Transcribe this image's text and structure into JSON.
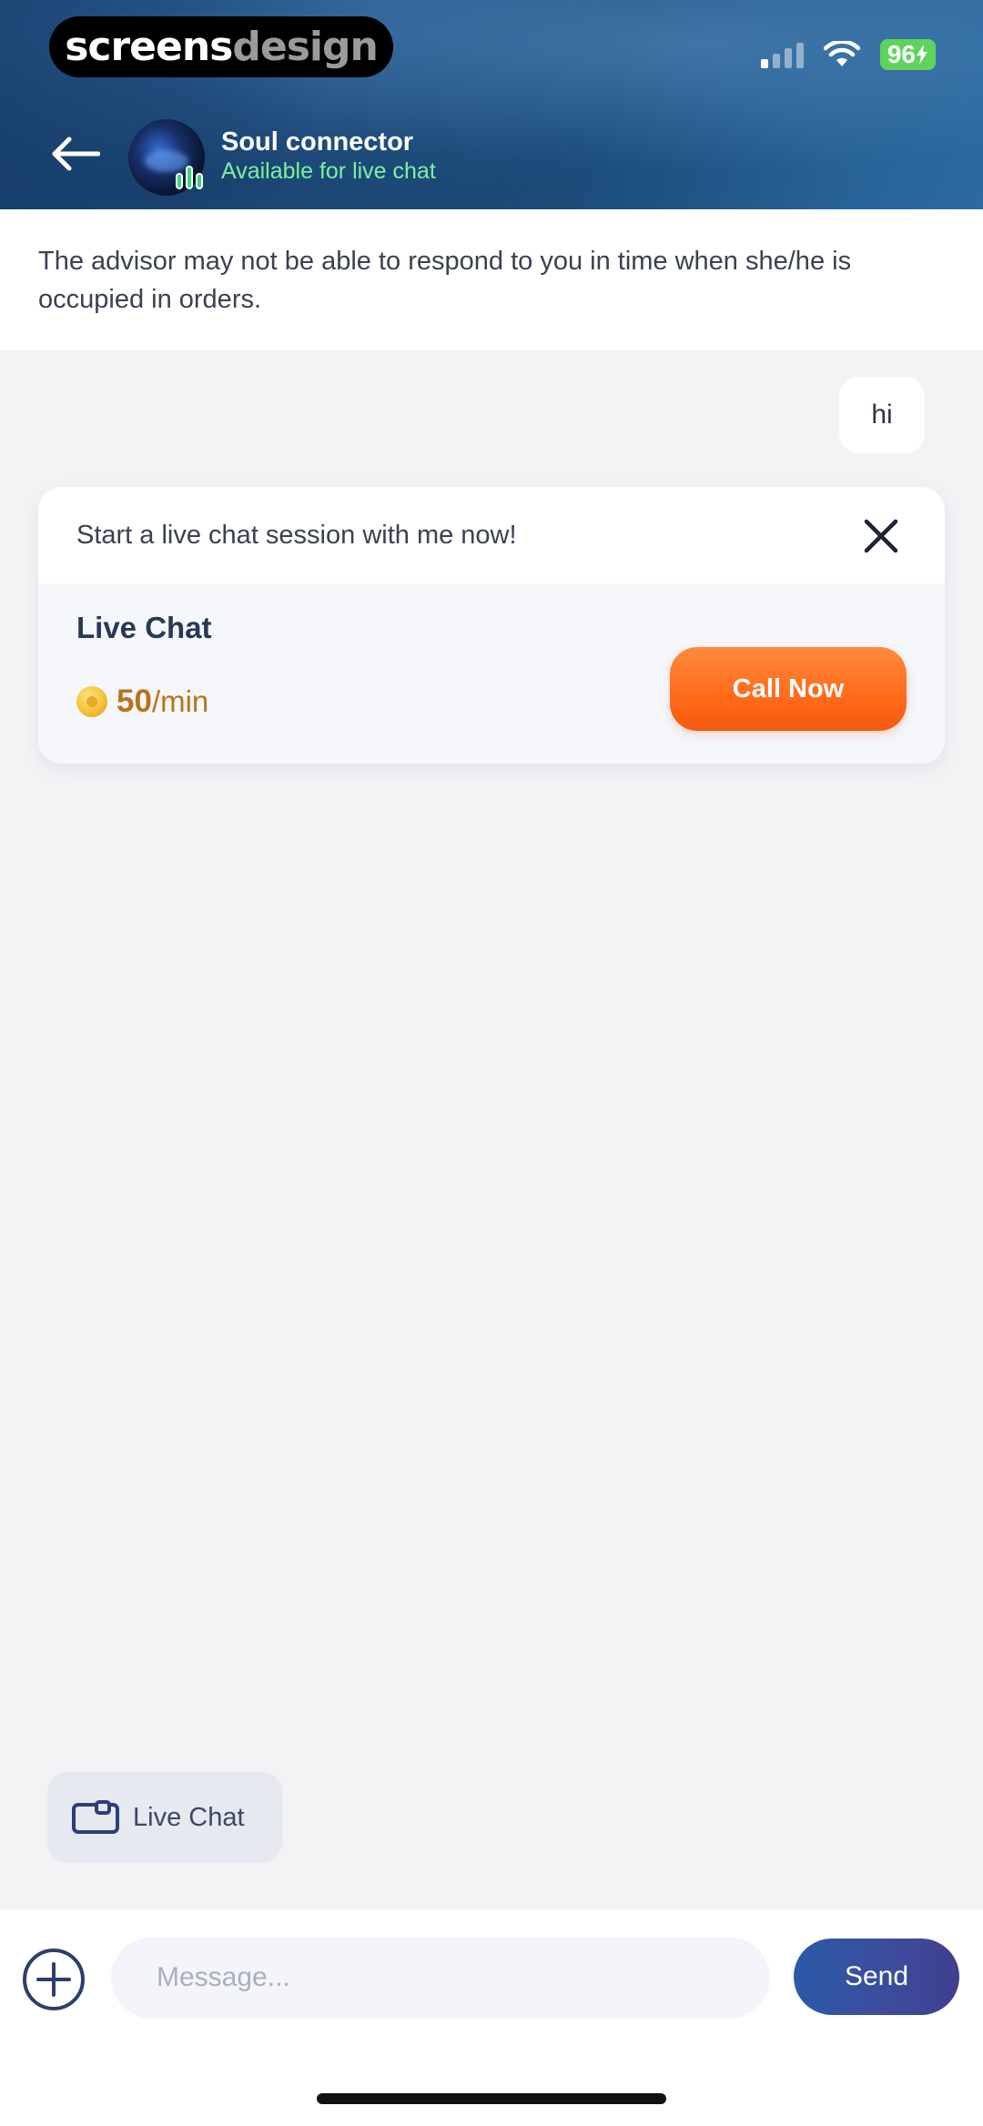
{
  "watermark": {
    "brand_main": "screens",
    "brand_muted": "design"
  },
  "status_bar": {
    "battery": "96",
    "signal_bars_active": 1
  },
  "header": {
    "contact_name": "Soul connector",
    "contact_status": "Available for live chat",
    "icons": {
      "back": "arrow-left-icon",
      "avatar": "advisor-avatar"
    }
  },
  "notice": {
    "text": "The advisor may not be able to respond to you in time when she/he is occupied in orders."
  },
  "messages": [
    {
      "direction": "outgoing",
      "text": "hi"
    }
  ],
  "live_chat_card": {
    "invite_text": "Start a live chat session with me now!",
    "title": "Live Chat",
    "price_value": "50",
    "price_unit": "/min",
    "call_button": "Call Now",
    "accent_color": "#ff6a1a"
  },
  "quick_action": {
    "label": "Live Chat",
    "icon": "live-chat-icon"
  },
  "composer": {
    "placeholder": "Message...",
    "value": "",
    "send_label": "Send",
    "add_icon": "plus-circle-icon"
  }
}
